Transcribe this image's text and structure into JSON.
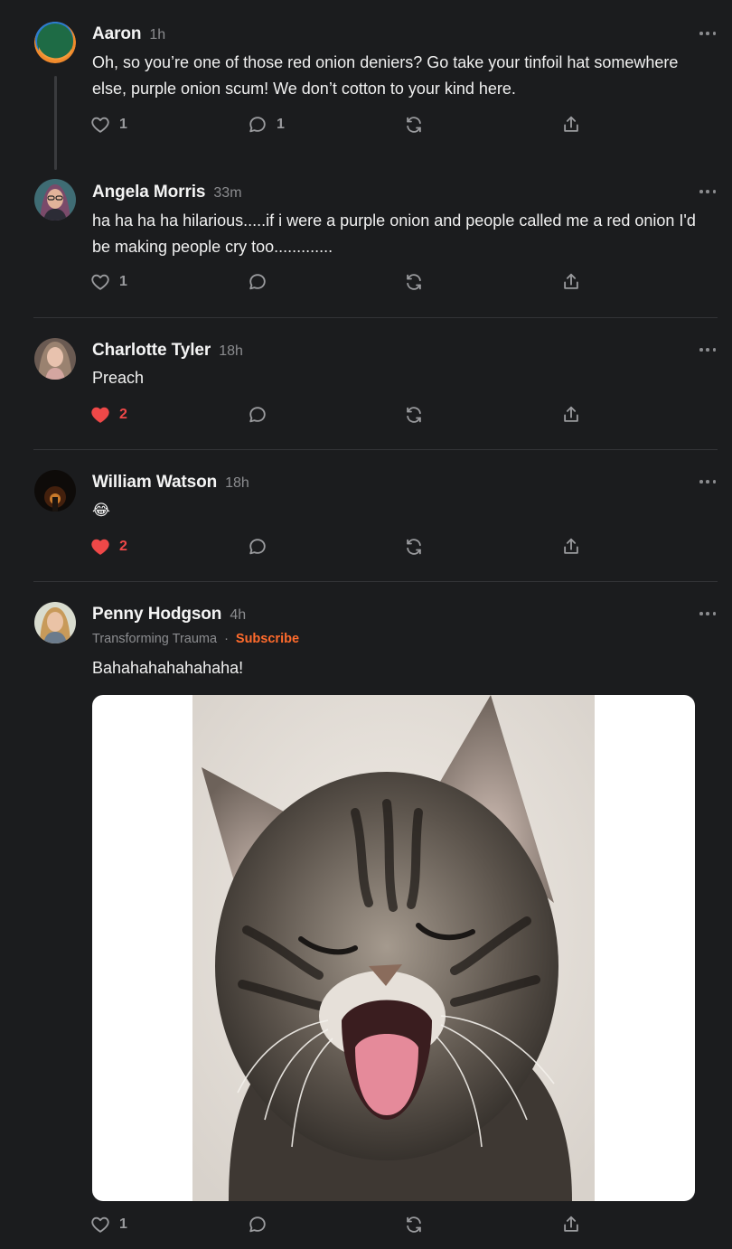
{
  "comments": [
    {
      "author": "Aaron",
      "time": "1h",
      "text": "Oh, so you’re one of those red onion deniers? Go take your tinfoil hat somewhere else, purple onion scum! We don’t cotton to your kind here.",
      "likes": "1",
      "replies": "1",
      "liked": false
    },
    {
      "author": "Angela Morris",
      "time": "33m",
      "text": "ha ha ha ha hilarious.....if i were a purple onion and people called me a red onion I'd be making people cry too.............",
      "likes": "1",
      "replies": "",
      "liked": false
    },
    {
      "author": "Charlotte Tyler",
      "time": "18h",
      "text": "Preach",
      "likes": "2",
      "replies": "",
      "liked": true
    },
    {
      "author": "William Watson",
      "time": "18h",
      "text": "😂",
      "likes": "2",
      "replies": "",
      "liked": true
    },
    {
      "author": "Penny Hodgson",
      "time": "4h",
      "publication": "Transforming Trauma",
      "subscribe_label": "Subscribe",
      "text": "Bahahahahahahaha!",
      "likes": "1",
      "replies": "",
      "liked": false,
      "image_alt": "laughing kitten"
    }
  ],
  "colors": {
    "background": "#1b1c1e",
    "like_active": "#ef4848",
    "subscribe": "#ff6b2c"
  },
  "icons": [
    "more-icon",
    "heart-icon",
    "comment-icon",
    "restack-icon",
    "share-icon"
  ]
}
